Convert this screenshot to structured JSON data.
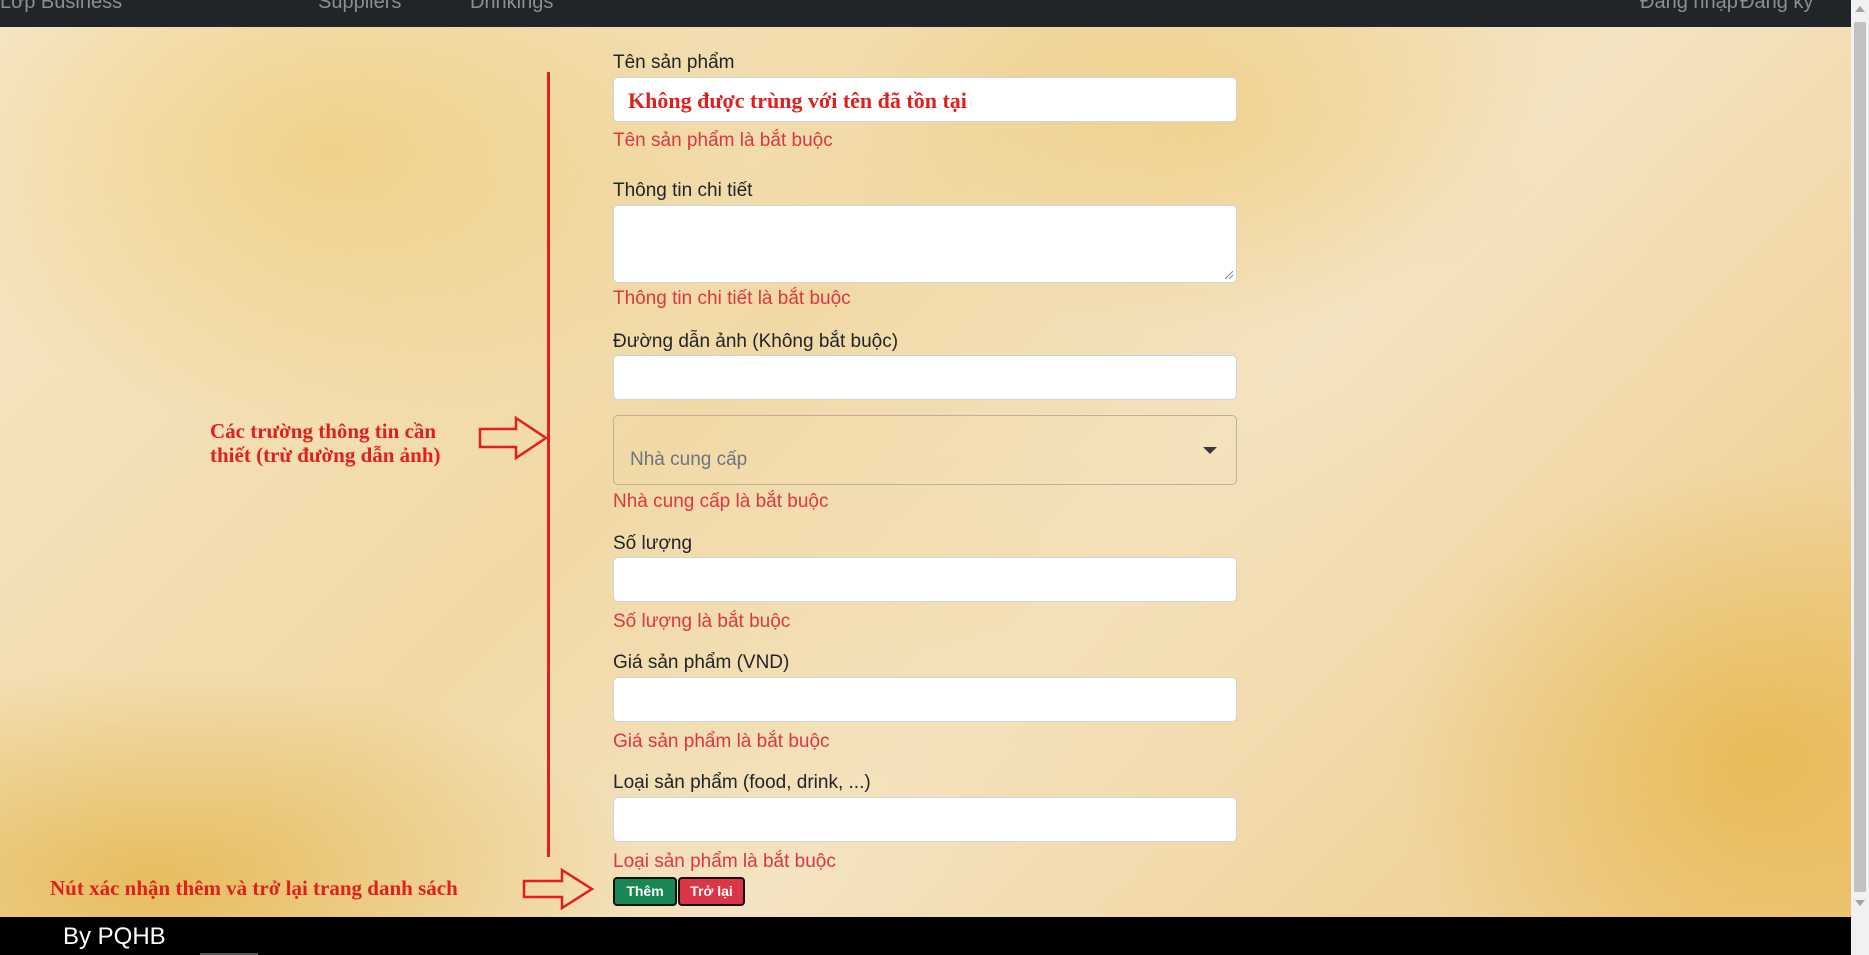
{
  "navbar": {
    "brand": "Lớp Business",
    "links": [
      "Suppliers",
      "Drinkings"
    ],
    "right_links": [
      "Đăng nhập",
      "Đăng ký"
    ]
  },
  "form": {
    "name": {
      "label": "Tên sản phẩm",
      "value": "Không được trùng với tên đã tồn tại",
      "error": "Tên sản phẩm là bắt buộc"
    },
    "detail": {
      "label": "Thông tin chi tiết",
      "value": "",
      "error": "Thông tin chi tiết là bắt buộc"
    },
    "image_url": {
      "label": "Đường dẫn ảnh (Không bắt buộc)",
      "value": ""
    },
    "supplier": {
      "placeholder": "Nhà cung cấp",
      "error": "Nhà cung cấp là bắt buộc"
    },
    "quantity": {
      "label": "Số lượng",
      "value": "",
      "error": "Số lượng là bắt buộc"
    },
    "price": {
      "label": "Giá sản phẩm (VND)",
      "value": "",
      "error": "Giá sản phẩm là bắt buộc"
    },
    "category": {
      "label": "Loại sản phẩm (food, drink, ...)",
      "value": "",
      "error": "Loại sản phẩm là bắt buộc"
    },
    "buttons": {
      "add": "Thêm",
      "back": "Trở lại"
    }
  },
  "annotations": {
    "fields_line1": "Các trường thông tin cần",
    "fields_line2": "thiết (trừ đường dẫn ảnh)",
    "buttons": "Nút xác nhận thêm và trở lại trang danh sách"
  },
  "footer": {
    "brand": "By PQHB"
  },
  "colors": {
    "error": "#dc3545",
    "annotation": "#e01f1f",
    "add_button": "#198754",
    "back_button": "#dc3545",
    "navbar": "#212529",
    "footer": "#000000"
  }
}
